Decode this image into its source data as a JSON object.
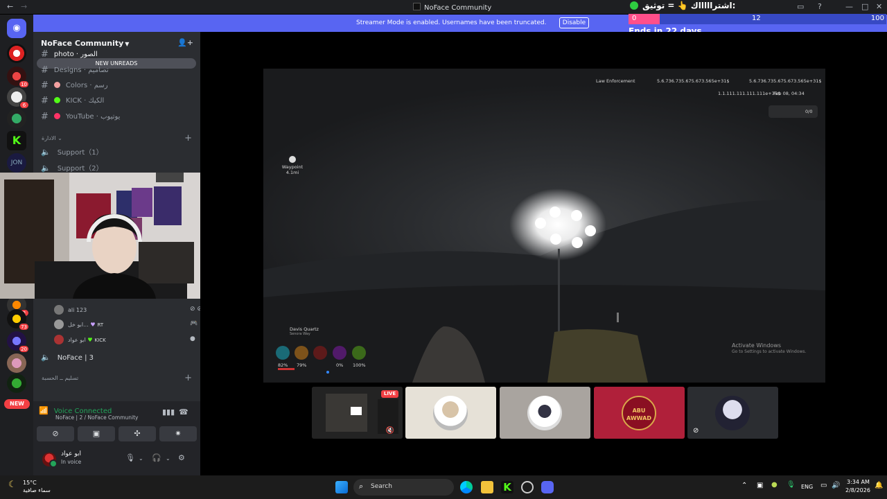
{
  "window": {
    "title": "NoFace Community",
    "nav_back": "←",
    "nav_forward": "→"
  },
  "banner": {
    "message": "Streamer Mode is enabled. Usernames have been truncated.",
    "disable_label": "Disable"
  },
  "overlay": {
    "goal_text": "اشتراااااك 👆 = توثيق:",
    "progress_min": "0",
    "progress_current": "12",
    "progress_max": "100",
    "progress_fraction": 0.12,
    "ends_text": "Ends in 22 days"
  },
  "guilds": {
    "badges": [
      "10",
      "6",
      "2",
      "73",
      "20"
    ],
    "new_label": "NEW"
  },
  "server": {
    "name": "NoFace Community",
    "new_unreads_label": "NEW UNREADS",
    "channels": [
      {
        "name": "photo · الصور",
        "color": "#949ba4"
      },
      {
        "name": "Designs · تصاميم",
        "color": "#f6a5c0"
      },
      {
        "name": "Colors · رسم",
        "color": "#f2a0a0"
      },
      {
        "name": "KICK · الكيك",
        "color": "#53fc18"
      },
      {
        "name": "YouTube · يوتيوب",
        "color": "#ff3366"
      }
    ],
    "category": "الادارة",
    "voice_channels": [
      {
        "name": "Support（1）"
      },
      {
        "name": "Support（2）"
      }
    ],
    "voice_users": [
      {
        "name": "ali 123",
        "tag": ""
      },
      {
        "name": "ابو خل...",
        "tag": "RT"
      },
      {
        "name": "ابو عواد",
        "tag": "KICK"
      }
    ],
    "voice_channel_3": "NoFace | 3",
    "category_2": "تسليم ــ الحسبة"
  },
  "voice_panel": {
    "status": "Voice Connected",
    "location": "NoFace | 2 / NoFace Community",
    "user_name": "ابو عواد",
    "user_status": "In voice"
  },
  "stage": {
    "hud": {
      "law": "Law Enforcement",
      "cash1": "5.6.736.735.675.673.565e+31$",
      "cash2": "5.6.736.735.675.673.565e+31$",
      "bank": "1.1.111.111.111.111e+35$",
      "date": "Feb 08, 04:34",
      "ammo": "0/0",
      "waypoint": "Waypoint",
      "waypoint_dist": "4.1mi",
      "location": "Davis Quartz",
      "location_sub": "Senora Way",
      "stats": [
        "82%",
        "79%",
        "",
        "0%",
        "100%"
      ],
      "activate": "Activate Windows",
      "activate_sub": "Go to Settings to activate Windows."
    },
    "live_label": "LIVE",
    "avatar_text": "ABU AWWAD"
  },
  "taskbar": {
    "weather_temp": "15°C",
    "weather_desc": "سماء صافية",
    "search_label": "Search",
    "lang": "ENG",
    "time": "3:34 AM",
    "date": "2/8/2026"
  }
}
